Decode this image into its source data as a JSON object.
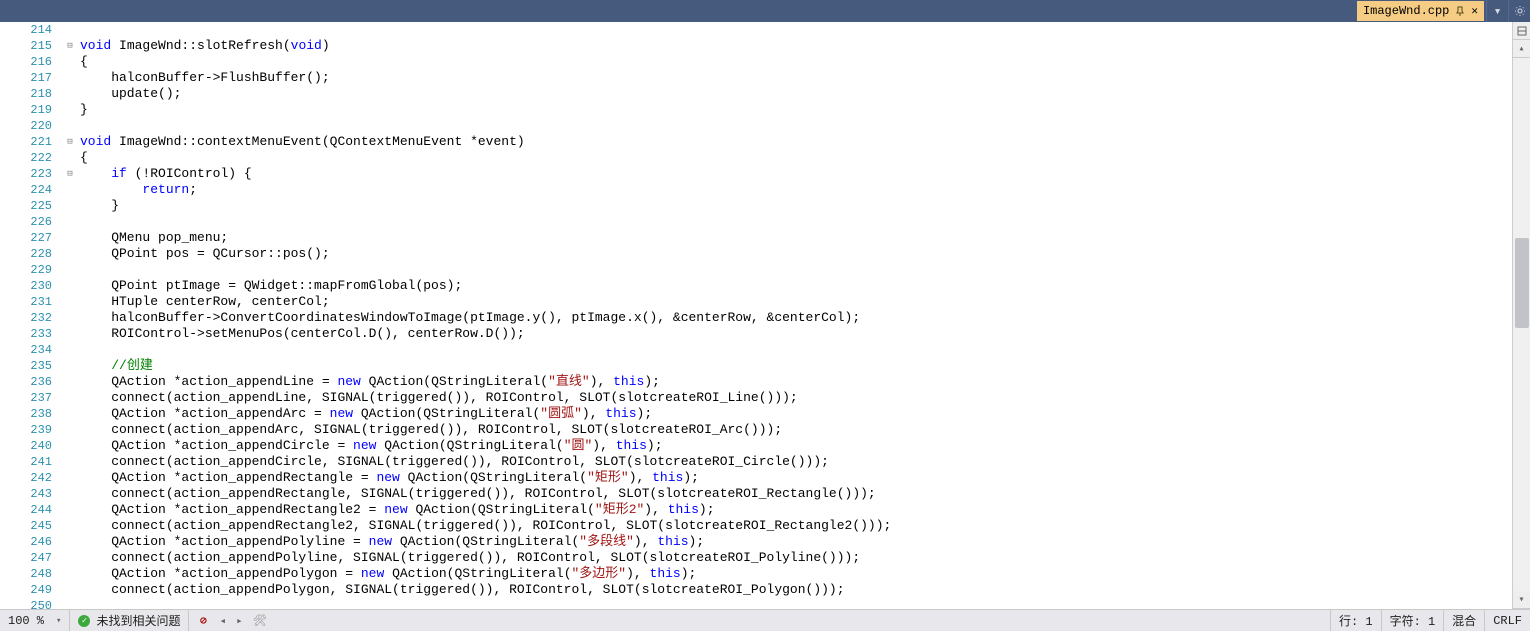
{
  "tab": {
    "filename": "ImageWnd.cpp"
  },
  "gutter": {
    "start": 214,
    "end": 250
  },
  "code": {
    "lines": [
      {
        "raw": "",
        "tokens": []
      },
      {
        "raw": "void ImageWnd::slotRefresh(void)",
        "tokens": [
          [
            "kw",
            "void"
          ],
          [
            "id",
            " ImageWnd::slotRefresh("
          ],
          [
            "kw",
            "void"
          ],
          [
            "id",
            ")"
          ]
        ],
        "box": "-"
      },
      {
        "raw": "{",
        "tokens": [
          [
            "id",
            "{"
          ]
        ]
      },
      {
        "raw": "    halconBuffer->FlushBuffer();",
        "tokens": [
          [
            "id",
            "    halconBuffer->FlushBuffer();"
          ]
        ]
      },
      {
        "raw": "    update();",
        "tokens": [
          [
            "id",
            "    update();"
          ]
        ]
      },
      {
        "raw": "}",
        "tokens": [
          [
            "id",
            "}"
          ]
        ]
      },
      {
        "raw": "",
        "tokens": []
      },
      {
        "raw": "void ImageWnd::contextMenuEvent(QContextMenuEvent *event)",
        "tokens": [
          [
            "kw",
            "void"
          ],
          [
            "id",
            " ImageWnd::contextMenuEvent(QContextMenuEvent *event)"
          ]
        ],
        "box": "-"
      },
      {
        "raw": "{",
        "tokens": [
          [
            "id",
            "{"
          ]
        ]
      },
      {
        "raw": "    if (!ROIControl) {",
        "tokens": [
          [
            "id",
            "    "
          ],
          [
            "kw",
            "if"
          ],
          [
            "id",
            " (!ROIControl) {"
          ]
        ],
        "box": "-"
      },
      {
        "raw": "        return;",
        "tokens": [
          [
            "id",
            "        "
          ],
          [
            "kw",
            "return"
          ],
          [
            "id",
            ";"
          ]
        ]
      },
      {
        "raw": "    }",
        "tokens": [
          [
            "id",
            "    }"
          ]
        ]
      },
      {
        "raw": "",
        "tokens": []
      },
      {
        "raw": "    QMenu pop_menu;",
        "tokens": [
          [
            "id",
            "    QMenu pop_menu;"
          ]
        ]
      },
      {
        "raw": "    QPoint pos = QCursor::pos();",
        "tokens": [
          [
            "id",
            "    QPoint pos = QCursor::pos();"
          ]
        ]
      },
      {
        "raw": "",
        "tokens": []
      },
      {
        "raw": "    QPoint ptImage = QWidget::mapFromGlobal(pos);",
        "tokens": [
          [
            "id",
            "    QPoint ptImage = QWidget::mapFromGlobal(pos);"
          ]
        ]
      },
      {
        "raw": "    HTuple centerRow, centerCol;",
        "tokens": [
          [
            "id",
            "    HTuple centerRow, centerCol;"
          ]
        ]
      },
      {
        "raw": "    halconBuffer->ConvertCoordinatesWindowToImage(ptImage.y(), ptImage.x(), &centerRow, &centerCol);",
        "tokens": [
          [
            "id",
            "    halconBuffer->ConvertCoordinatesWindowToImage(ptImage.y(), ptImage.x(), &centerRow, &centerCol);"
          ]
        ]
      },
      {
        "raw": "    ROIControl->setMenuPos(centerCol.D(), centerRow.D());",
        "tokens": [
          [
            "id",
            "    ROIControl->setMenuPos(centerCol.D(), centerRow.D());"
          ]
        ]
      },
      {
        "raw": "",
        "tokens": []
      },
      {
        "raw": "    //创建",
        "tokens": [
          [
            "id",
            "    "
          ],
          [
            "cmt",
            "//创建"
          ]
        ]
      },
      {
        "raw": "    QAction *action_appendLine = new QAction(QStringLiteral(\"直线\"), this);",
        "tokens": [
          [
            "id",
            "    QAction *action_appendLine = "
          ],
          [
            "kw",
            "new"
          ],
          [
            "id",
            " QAction(QStringLiteral("
          ],
          [
            "str",
            "\"直线\""
          ],
          [
            "id",
            "), "
          ],
          [
            "kw",
            "this"
          ],
          [
            "id",
            ");"
          ]
        ]
      },
      {
        "raw": "    connect(action_appendLine, SIGNAL(triggered()), ROIControl, SLOT(slotcreateROI_Line()));",
        "tokens": [
          [
            "id",
            "    connect(action_appendLine, SIGNAL(triggered()), ROIControl, SLOT(slotcreateROI_Line()));"
          ]
        ]
      },
      {
        "raw": "    QAction *action_appendArc = new QAction(QStringLiteral(\"圆弧\"), this);",
        "tokens": [
          [
            "id",
            "    QAction *action_appendArc = "
          ],
          [
            "kw",
            "new"
          ],
          [
            "id",
            " QAction(QStringLiteral("
          ],
          [
            "str",
            "\"圆弧\""
          ],
          [
            "id",
            "), "
          ],
          [
            "kw",
            "this"
          ],
          [
            "id",
            ");"
          ]
        ]
      },
      {
        "raw": "    connect(action_appendArc, SIGNAL(triggered()), ROIControl, SLOT(slotcreateROI_Arc()));",
        "tokens": [
          [
            "id",
            "    connect(action_appendArc, SIGNAL(triggered()), ROIControl, SLOT(slotcreateROI_Arc()));"
          ]
        ]
      },
      {
        "raw": "    QAction *action_appendCircle = new QAction(QStringLiteral(\"圆\"), this);",
        "tokens": [
          [
            "id",
            "    QAction *action_appendCircle = "
          ],
          [
            "kw",
            "new"
          ],
          [
            "id",
            " QAction(QStringLiteral("
          ],
          [
            "str",
            "\"圆\""
          ],
          [
            "id",
            "), "
          ],
          [
            "kw",
            "this"
          ],
          [
            "id",
            ");"
          ]
        ]
      },
      {
        "raw": "    connect(action_appendCircle, SIGNAL(triggered()), ROIControl, SLOT(slotcreateROI_Circle()));",
        "tokens": [
          [
            "id",
            "    connect(action_appendCircle, SIGNAL(triggered()), ROIControl, SLOT(slotcreateROI_Circle()));"
          ]
        ]
      },
      {
        "raw": "    QAction *action_appendRectangle = new QAction(QStringLiteral(\"矩形\"), this);",
        "tokens": [
          [
            "id",
            "    QAction *action_appendRectangle = "
          ],
          [
            "kw",
            "new"
          ],
          [
            "id",
            " QAction(QStringLiteral("
          ],
          [
            "str",
            "\"矩形\""
          ],
          [
            "id",
            "), "
          ],
          [
            "kw",
            "this"
          ],
          [
            "id",
            ");"
          ]
        ]
      },
      {
        "raw": "    connect(action_appendRectangle, SIGNAL(triggered()), ROIControl, SLOT(slotcreateROI_Rectangle()));",
        "tokens": [
          [
            "id",
            "    connect(action_appendRectangle, SIGNAL(triggered()), ROIControl, SLOT(slotcreateROI_Rectangle()));"
          ]
        ]
      },
      {
        "raw": "    QAction *action_appendRectangle2 = new QAction(QStringLiteral(\"矩形2\"), this);",
        "tokens": [
          [
            "id",
            "    QAction *action_appendRectangle2 = "
          ],
          [
            "kw",
            "new"
          ],
          [
            "id",
            " QAction(QStringLiteral("
          ],
          [
            "str",
            "\"矩形2\""
          ],
          [
            "id",
            "), "
          ],
          [
            "kw",
            "this"
          ],
          [
            "id",
            ");"
          ]
        ]
      },
      {
        "raw": "    connect(action_appendRectangle2, SIGNAL(triggered()), ROIControl, SLOT(slotcreateROI_Rectangle2()));",
        "tokens": [
          [
            "id",
            "    connect(action_appendRectangle2, SIGNAL(triggered()), ROIControl, SLOT(slotcreateROI_Rectangle2()));"
          ]
        ]
      },
      {
        "raw": "    QAction *action_appendPolyline = new QAction(QStringLiteral(\"多段线\"), this);",
        "tokens": [
          [
            "id",
            "    QAction *action_appendPolyline = "
          ],
          [
            "kw",
            "new"
          ],
          [
            "id",
            " QAction(QStringLiteral("
          ],
          [
            "str",
            "\"多段线\""
          ],
          [
            "id",
            "), "
          ],
          [
            "kw",
            "this"
          ],
          [
            "id",
            ");"
          ]
        ]
      },
      {
        "raw": "    connect(action_appendPolyline, SIGNAL(triggered()), ROIControl, SLOT(slotcreateROI_Polyline()));",
        "tokens": [
          [
            "id",
            "    connect(action_appendPolyline, SIGNAL(triggered()), ROIControl, SLOT(slotcreateROI_Polyline()));"
          ]
        ]
      },
      {
        "raw": "    QAction *action_appendPolygon = new QAction(QStringLiteral(\"多边形\"), this);",
        "tokens": [
          [
            "id",
            "    QAction *action_appendPolygon = "
          ],
          [
            "kw",
            "new"
          ],
          [
            "id",
            " QAction(QStringLiteral("
          ],
          [
            "str",
            "\"多边形\""
          ],
          [
            "id",
            "), "
          ],
          [
            "kw",
            "this"
          ],
          [
            "id",
            ");"
          ]
        ]
      },
      {
        "raw": "    connect(action_appendPolygon, SIGNAL(triggered()), ROIControl, SLOT(slotcreateROI_Polygon()));",
        "tokens": [
          [
            "id",
            "    connect(action_appendPolygon, SIGNAL(triggered()), ROIControl, SLOT(slotcreateROI_Polygon()));"
          ]
        ]
      },
      {
        "raw": "",
        "tokens": []
      }
    ]
  },
  "status": {
    "zoom": "100 %",
    "issues_text": "未找到相关问题",
    "line_label": "行: 1",
    "char_label": "字符: 1",
    "indent_label": "混合",
    "eol_label": "CRLF"
  }
}
